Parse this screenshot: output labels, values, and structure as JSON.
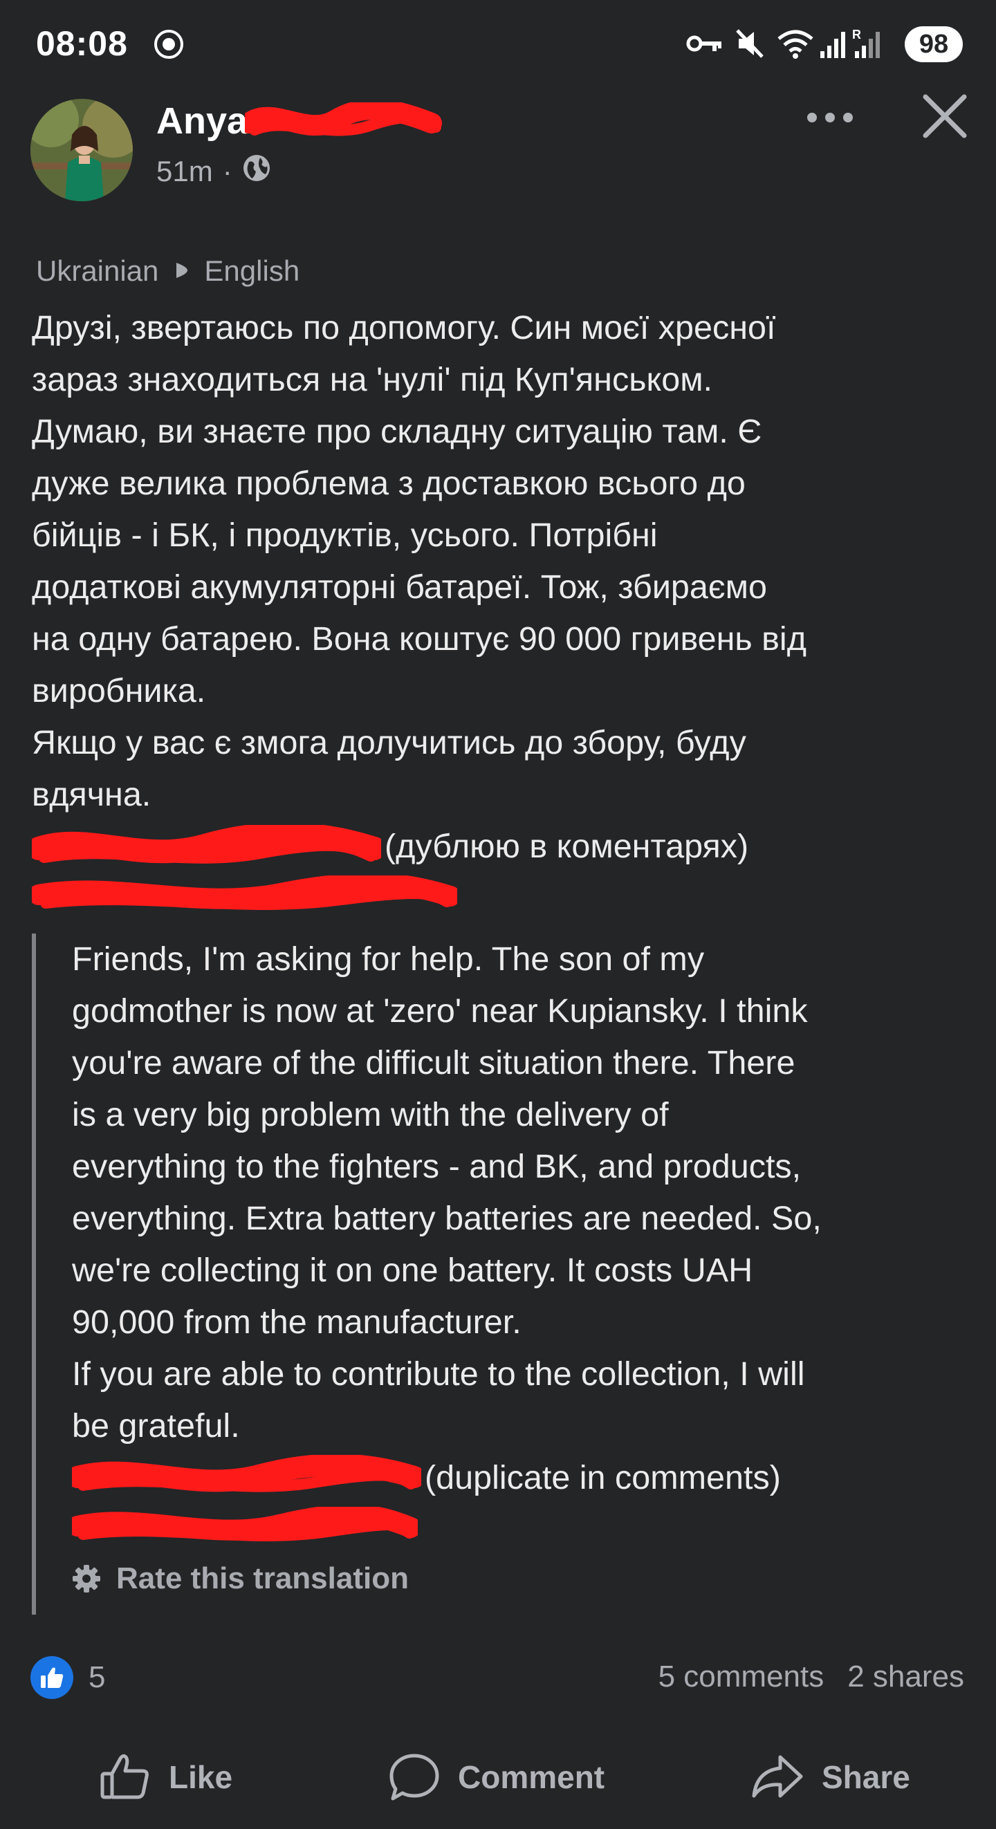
{
  "status_bar": {
    "time": "08:08",
    "battery": "98",
    "icons": [
      "key-icon",
      "mute-icon",
      "wifi-icon",
      "signal-icon",
      "signal-roaming-icon"
    ]
  },
  "post": {
    "author_name": "Anya",
    "time_ago": "51m",
    "meta_separator": "·",
    "audience_icon": "globe-icon",
    "translation": {
      "from": "Ukrainian",
      "to": "English"
    },
    "original_lines": [
      "Друзі, звертаюсь по допомогу. Син моєї хресної",
      "зараз знаходиться на 'нулі' під Куп'янськом.",
      "Думаю, ви знаєте про складну ситуацію там. Є",
      "дуже велика проблема з доставкою всього до",
      "бійців - і БК, і продуктів, усього. Потрібні",
      "додаткові акумуляторні батареї. Тож, збираємо",
      "на одну батарею. Вона коштує 90 000 гривень від",
      "виробника.",
      "Якщо у вас є змога долучитись до збору, буду",
      "вдячна."
    ],
    "original_redacted_suffix": "(дублюю в коментарях)",
    "translated_lines": [
      "Friends, I'm asking for help. The son of my",
      "godmother is now at 'zero' near Kupiansky. I think",
      "you're aware of the difficult situation there. There",
      "is a very big problem with the delivery of",
      "everything to the fighters - and BK, and products,",
      "everything. Extra battery batteries are needed. So,",
      "we're collecting it on one battery. It costs UAH",
      "90,000 from the manufacturer.",
      "If you are able to contribute to the collection, I will",
      "be grateful."
    ],
    "translated_redacted_suffix": "(duplicate in comments)",
    "rate_translation_label": "Rate this translation"
  },
  "engagement": {
    "reaction_count": "5",
    "comments": "5 comments",
    "shares": "2 shares"
  },
  "actions": {
    "like": "Like",
    "comment": "Comment",
    "share": "Share"
  },
  "colors": {
    "background": "#242527",
    "text": "#ececec",
    "secondary_text": "#b0b3b8",
    "like_blue": "#1b74e4",
    "redaction_red": "#ff1a1a"
  }
}
